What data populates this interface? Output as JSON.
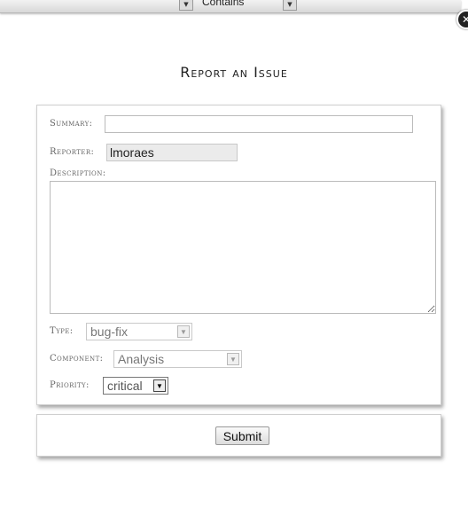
{
  "toolbar": {
    "filter_operator": "Contains",
    "arrow_glyph": "▼",
    "close_glyph": "✕"
  },
  "page": {
    "title": "Report an Issue"
  },
  "form": {
    "summary_label": "Summary:",
    "summary_value": "",
    "reporter_label": "Reporter:",
    "reporter_value": "lmoraes",
    "description_label": "Description:",
    "description_value": "",
    "type_label": "Type:",
    "type_value": "bug-fix",
    "component_label": "Component:",
    "component_value": "Analysis",
    "priority_label": "Priority:",
    "priority_value": "critical",
    "arrow_glyph": "▼"
  },
  "actions": {
    "submit_label": "Submit"
  }
}
